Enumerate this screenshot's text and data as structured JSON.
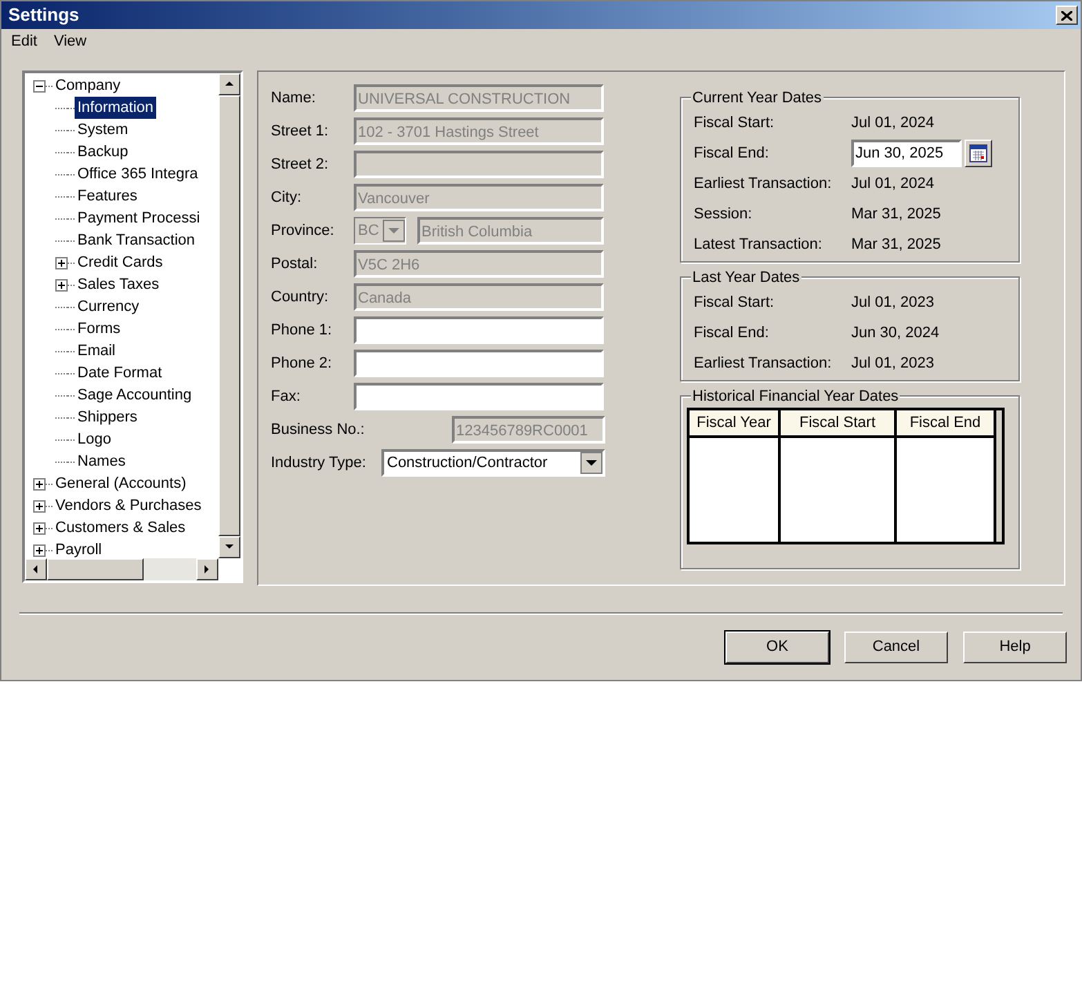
{
  "window": {
    "title": "Settings"
  },
  "menu": [
    "Edit",
    "View"
  ],
  "tree": [
    {
      "label": "Company",
      "expanded": true,
      "selected": false,
      "children": [
        {
          "label": "Information",
          "selected": true
        },
        {
          "label": "System",
          "selected": false
        },
        {
          "label": "Backup",
          "selected": false
        },
        {
          "label": "Office 365 Integra",
          "selected": false
        },
        {
          "label": "Features",
          "selected": false
        },
        {
          "label": "Payment Processi",
          "selected": false
        },
        {
          "label": "Bank Transaction",
          "selected": false
        },
        {
          "label": "Credit Cards",
          "selected": false,
          "expanded": false
        },
        {
          "label": "Sales Taxes",
          "selected": false,
          "expanded": false
        },
        {
          "label": "Currency",
          "selected": false
        },
        {
          "label": "Forms",
          "selected": false
        },
        {
          "label": "Email",
          "selected": false
        },
        {
          "label": "Date Format",
          "selected": false
        },
        {
          "label": "Sage Accounting",
          "selected": false
        },
        {
          "label": "Shippers",
          "selected": false
        },
        {
          "label": "Logo",
          "selected": false
        },
        {
          "label": "Names",
          "selected": false
        }
      ]
    },
    {
      "label": "General (Accounts)",
      "expanded": false,
      "selected": false
    },
    {
      "label": "Vendors & Purchases",
      "expanded": false,
      "selected": false
    },
    {
      "label": "Customers & Sales",
      "expanded": false,
      "selected": false
    },
    {
      "label": "Payroll",
      "expanded": false,
      "selected": false
    }
  ],
  "form": [
    {
      "kind": "text",
      "label": "Name:",
      "value": "UNIVERSAL CONSTRUCTION",
      "disabled": true
    },
    {
      "kind": "text",
      "label": "Street 1:",
      "value": "102 - 3701 Hastings Street",
      "disabled": true
    },
    {
      "kind": "text",
      "label": "Street 2:",
      "disabled": true
    },
    {
      "kind": "text",
      "label": "City:",
      "value": "Vancouver",
      "disabled": true
    },
    {
      "kind": "province",
      "label": "Province:",
      "code": "BC",
      "value": "British Columbia",
      "disabled": true
    },
    {
      "kind": "text",
      "label": "Postal:",
      "value": "V5C 2H6",
      "disabled": true
    },
    {
      "kind": "text",
      "label": "Country:",
      "value": "Canada",
      "disabled": true
    },
    {
      "kind": "text",
      "label": "Phone 1:",
      "disabled": false
    },
    {
      "kind": "text",
      "label": "Phone 2:",
      "disabled": false
    },
    {
      "kind": "text",
      "label": "Fax:",
      "disabled": false
    },
    {
      "kind": "short",
      "label": "Business No.:",
      "value": "123456789RC0001",
      "disabled": true
    },
    {
      "kind": "select",
      "label": "Industry Type:",
      "value": "Construction/Contractor",
      "disabled": false
    }
  ],
  "current_year": {
    "title": "Current Year Dates",
    "rows": [
      {
        "label": "Fiscal Start:",
        "value": "Jul 01, 2024",
        "kind": "text"
      },
      {
        "label": "Fiscal End:",
        "value": "Jun 30, 2025",
        "kind": "date"
      },
      {
        "label": "Earliest Transaction:",
        "value": "Jul 01, 2024",
        "kind": "text"
      },
      {
        "label": "Session:",
        "value": "Mar 31, 2025",
        "kind": "text"
      },
      {
        "label": "Latest Transaction:",
        "value": "Mar 31, 2025",
        "kind": "text"
      }
    ]
  },
  "last_year": {
    "title": "Last Year Dates",
    "rows": [
      {
        "label": "Fiscal Start:",
        "value": "Jul 01, 2023",
        "kind": "text"
      },
      {
        "label": "Fiscal End:",
        "value": "Jun 30, 2024",
        "kind": "text"
      },
      {
        "label": "Earliest Transaction:",
        "value": "Jul 01, 2023",
        "kind": "text"
      }
    ]
  },
  "historical": {
    "title": "Historical Financial Year Dates",
    "columns": [
      "Fiscal Year",
      "Fiscal Start",
      "Fiscal End"
    ]
  },
  "buttons": [
    {
      "label": "OK",
      "default": true
    },
    {
      "label": "Cancel",
      "default": false
    },
    {
      "label": "Help",
      "default": false
    }
  ]
}
